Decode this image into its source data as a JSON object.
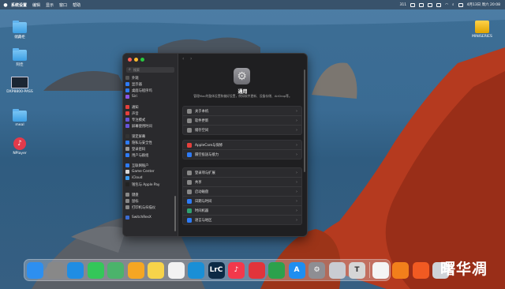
{
  "menubar": {
    "apple": "",
    "items": [
      "系统设置",
      "编辑",
      "显示",
      "窗口",
      "帮助"
    ],
    "time": "4月13日 周六 20:08",
    "status_text": "311"
  },
  "desktop": {
    "icons": [
      "储藏柜",
      "阿佳",
      "DXP8800-PASS",
      "meal",
      "NPlayer",
      "MINISERIES"
    ]
  },
  "window": {
    "search_placeholder": "搜索",
    "sidebar": [
      {
        "label": "外观",
        "color": "#555"
      },
      {
        "label": "显示器",
        "color": "#2e7bf6"
      },
      {
        "label": "桌面与程序坞",
        "color": "#2e7bf6"
      },
      {
        "label": "Siri",
        "color": "#8a55e8"
      },
      {
        "label": "通知",
        "color": "#e5403c"
      },
      {
        "label": "声音",
        "color": "#e5403c"
      },
      {
        "label": "专注模式",
        "color": "#6554d9"
      },
      {
        "label": "屏幕使用时间",
        "color": "#6554d9"
      },
      {
        "label": "锁定屏幕",
        "color": "#333"
      },
      {
        "label": "隐私与安全性",
        "color": "#2e7bf6"
      },
      {
        "label": "登录密码",
        "color": "#999"
      },
      {
        "label": "用户与群组",
        "color": "#2e7bf6"
      },
      {
        "label": "互联网账户",
        "color": "#2e7bf6"
      },
      {
        "label": "Game Center",
        "color": "#d8d8d8"
      },
      {
        "label": "iCloud",
        "color": "#3a9bf0"
      },
      {
        "label": "钱包与 Apple Pay",
        "color": "#222"
      },
      {
        "label": "键盘",
        "color": "#888"
      },
      {
        "label": "鼠标",
        "color": "#888"
      },
      {
        "label": "打印机与扫描仪",
        "color": "#888"
      },
      {
        "label": "SwitchResX",
        "color": "#3a6bd0"
      }
    ],
    "general": {
      "title": "通用",
      "description": "管理Mac的整体设置和偏好设置，例如软件更新、设备存储、AirDrop等。",
      "groups": [
        [
          {
            "label": "关于本机",
            "color": "#888"
          },
          {
            "label": "软件更新",
            "color": "#888"
          },
          {
            "label": "储存空间",
            "color": "#888"
          }
        ],
        [
          {
            "label": "AppleCare与保修",
            "color": "#e5403c"
          },
          {
            "label": "隔空投送与接力",
            "color": "#2e7bf6"
          }
        ],
        [
          {
            "label": "登录项与扩展",
            "color": "#888"
          },
          {
            "label": "共享",
            "color": "#888"
          },
          {
            "label": "启动磁盘",
            "color": "#888"
          },
          {
            "label": "日期与时间",
            "color": "#2e7bf6"
          },
          {
            "label": "时间机器",
            "color": "#30a070"
          },
          {
            "label": "语言与地区",
            "color": "#2e7bf6"
          }
        ]
      ]
    }
  },
  "dock": {
    "apps": [
      {
        "name": "finder",
        "label": "",
        "color": "#2d8ff0"
      },
      {
        "name": "launchpad",
        "label": "",
        "color": "#888"
      },
      {
        "name": "safari",
        "label": "",
        "color": "#1f8de3"
      },
      {
        "name": "messages",
        "label": "",
        "color": "#34c759"
      },
      {
        "name": "maps",
        "label": "",
        "color": "#4bb36b"
      },
      {
        "name": "photos",
        "label": "",
        "color": "#f5a623"
      },
      {
        "name": "notes",
        "label": "",
        "color": "#f7d34a"
      },
      {
        "name": "freeform",
        "label": "",
        "color": "#f2f2f2"
      },
      {
        "name": "edge",
        "label": "",
        "color": "#1a8fd6"
      },
      {
        "name": "lightroom-classic",
        "label": "LrC",
        "color": "#0c2a45"
      },
      {
        "name": "music",
        "label": "♪",
        "color": "#f2384c"
      },
      {
        "name": "netease-music",
        "label": "",
        "color": "#e1343b"
      },
      {
        "name": "numbers",
        "label": "",
        "color": "#2ca14c"
      },
      {
        "name": "app-store",
        "label": "A",
        "color": "#1f8ef0"
      },
      {
        "name": "system-settings",
        "label": "⚙",
        "color": "#8e8e93"
      },
      {
        "name": "iphone-mirroring",
        "label": "",
        "color": "#c9ccd2"
      },
      {
        "name": "typora",
        "label": "T",
        "color": "#d6d6d6"
      },
      {
        "name": "chrome",
        "label": "",
        "color": "#f4f4f4"
      },
      {
        "name": "books",
        "label": "",
        "color": "#f27f1b"
      },
      {
        "name": "brave",
        "label": "",
        "color": "#f15a22"
      },
      {
        "name": "trash",
        "label": "",
        "color": "#cfd3d8"
      }
    ]
  },
  "watermark": "曙华凋"
}
